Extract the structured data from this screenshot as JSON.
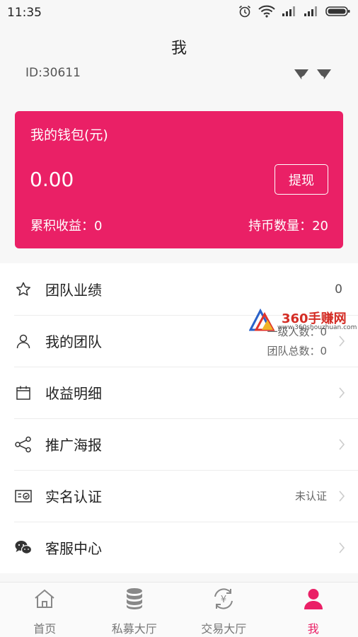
{
  "status_bar": {
    "time": "11:35"
  },
  "header": {
    "title": "我",
    "user_id": "ID:30611"
  },
  "wallet": {
    "title": "我的钱包(元)",
    "amount": "0.00",
    "withdraw_label": "提现",
    "earnings": "累积收益：0",
    "coins": "持币数量：20",
    "color": "#ea2066"
  },
  "menu": [
    {
      "label": "团队业绩",
      "icon": "star-icon",
      "value": "0"
    },
    {
      "label": "我的团队",
      "icon": "person-icon",
      "line1": "一级人数：0",
      "line2": "团队总数：0"
    },
    {
      "label": "收益明细",
      "icon": "calendar-icon"
    },
    {
      "label": "推广海报",
      "icon": "share-icon"
    },
    {
      "label": "实名认证",
      "icon": "id-card-icon",
      "status": "未认证"
    },
    {
      "label": "客服中心",
      "icon": "wechat-icon"
    }
  ],
  "watermark": {
    "text": "360手赚网",
    "url": "www.360shouzhuan.com"
  },
  "bottom_nav": [
    {
      "label": "首页",
      "icon": "home-icon",
      "active": false
    },
    {
      "label": "私募大厅",
      "icon": "database-icon",
      "active": false
    },
    {
      "label": "交易大厅",
      "icon": "exchange-icon",
      "active": false
    },
    {
      "label": "我",
      "icon": "user-icon",
      "active": true
    }
  ]
}
